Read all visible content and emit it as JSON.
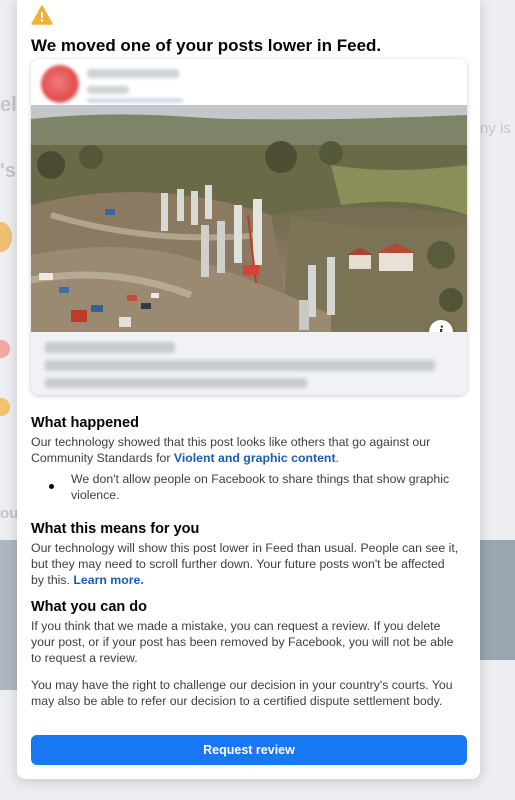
{
  "modal": {
    "title": "We moved one of your posts lower in Feed.",
    "icons": {
      "warning": "warning-triangle-icon",
      "info": "info-icon"
    },
    "post_preview": {
      "info_glyph": "i"
    },
    "what_happened": {
      "heading": "What happened",
      "text": "Our technology showed that this post looks like others that go against our Community Standards for ",
      "link": "Violent and graphic content",
      "text_end": ".",
      "bullet": "We don't allow people on Facebook to share things that show graphic violence."
    },
    "what_this_means": {
      "heading": "What this means for you",
      "text": "Our technology will show this post lower in Feed than usual. People can see it, but they may need to scroll further down. Your future posts won't be affected by this. ",
      "link": "Learn more."
    },
    "what_you_can_do": {
      "heading": "What you can do",
      "text1": "If you think that we made a mistake, you can request a review. If you delete your post, or if your post has been removed by Facebook, you will not be able to request a review.",
      "text2": "You may have the right to challenge our decision in your country's courts. You may also be able to refer our decision to a certified dispute settlement body."
    },
    "request_review_label": "Request review"
  },
  "colors": {
    "primary": "#1877f2",
    "link": "#1b5db8",
    "warning": "#f2b134"
  }
}
